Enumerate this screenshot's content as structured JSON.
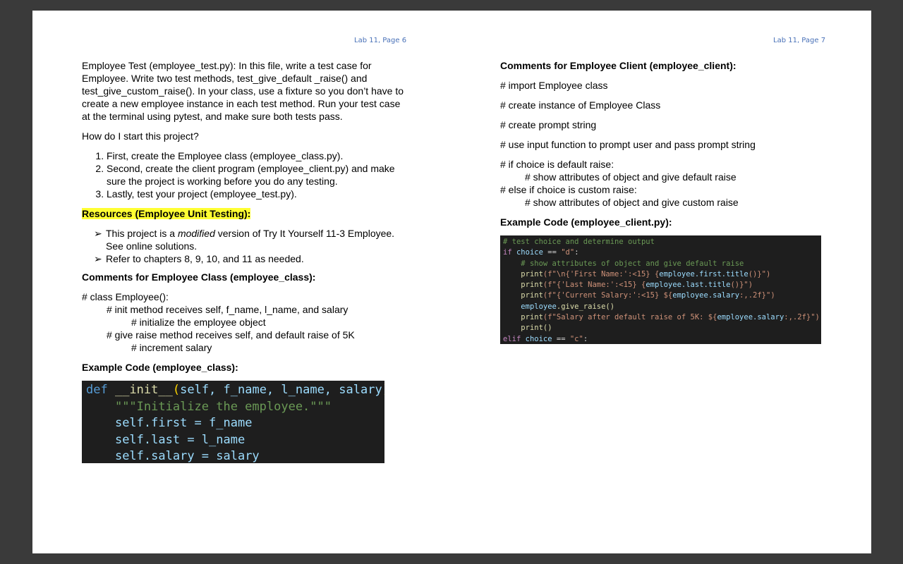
{
  "left_page": {
    "header": "Lab 11, Page 6",
    "intro": "Employee Test (employee_test.py):  In this file, write a test case for Employee. Write two test methods, test_give_default _raise() and test_give_custom_raise().  In your class, use a fixture so you don’t have to create a new employee instance in each test method. Run your test case at the terminal using pytest, and make sure both tests pass.",
    "question": "How do I start this project?",
    "steps": [
      "First, create the Employee class (employee_class.py).",
      "Second, create the client program (employee_client.py) and make sure the project is working before you do any testing.",
      "Lastly, test your project (employee_test.py)."
    ],
    "resources_heading": "Resources (Employee Unit Testing):",
    "resources": {
      "item1_pre": "This project is a ",
      "item1_em": "modified",
      "item1_post": " version of Try It Yourself 11-3 Employee. See online solutions.",
      "item2": "Refer to chapters 8, 9, 10, and 11 as needed.",
      "arrow": "➢"
    },
    "comments_heading": "Comments for Employee Class (employee_class):",
    "comments": [
      "# class Employee():",
      "# init method receives self, f_name, l_name, and salary",
      "# initialize the employee object",
      "# give raise method receives self, and default raise of 5K",
      "# increment salary"
    ],
    "example_heading": "Example Code (employee_class):",
    "code": {
      "l1_def": "def",
      "l1_name": "__init__",
      "l1_open": "(",
      "l1_params": "self, f_name, l_name, salary",
      "l1_close": ")",
      "l1_colon": ":",
      "l2_doc": "\"\"\"Initialize the employee.\"\"\"",
      "l3_self": "self",
      "l3_rest": ".first = f_name",
      "l4_self": "self",
      "l4_rest": ".last = l_name",
      "l5_self": "self",
      "l5_rest": ".salary = salary"
    }
  },
  "right_page": {
    "header": "Lab 11, Page 7",
    "comments_heading": "Comments for Employee Client (employee_client):",
    "comments": [
      "# import Employee class",
      "# create instance of Employee Class",
      "# create prompt string",
      "# use input function to prompt user and pass prompt string",
      "# if choice is default raise:",
      "# show attributes of object and give default raise",
      "# else if choice is custom raise:",
      "# show attributes of object and give custom raise"
    ],
    "example_heading": "Example Code (employee_client.py):",
    "code": {
      "l1": "# test choice and determine output",
      "l2_if": "if",
      "l2_var": "choice",
      "l2_op": " == ",
      "l2_str": "\"d\"",
      "l2_colon": ":",
      "l3": "# show attributes of object and give default raise",
      "l4_fn": "print",
      "l4_a": "(f\"\\n{'First Name:'",
      "l4_b": ":<15} {",
      "l4_c": "employee.first.title",
      "l4_d": "()}\")",
      "l5_fn": "print",
      "l5_a": "(f\"{'Last Name:'",
      "l5_b": ":<15} {",
      "l5_c": "employee.last.title",
      "l5_d": "()}\")",
      "l6_fn": "print",
      "l6_a": "(f\"{'Current Salary:'",
      "l6_b": ":<15} ${",
      "l6_c": "employee.salary",
      "l6_d": ":,.2f}\")",
      "l7_var": "employee",
      "l7_rest": ".give_raise()",
      "l8_fn": "print",
      "l8_a": "(f\"Salary after default raise of 5K: ${",
      "l8_c": "employee.salary",
      "l8_d": ":,.2f}\")",
      "l9": "print()",
      "l10_elif": "elif",
      "l10_var": "choice",
      "l10_op": " == ",
      "l10_str": "\"c\"",
      "l10_colon": ":"
    }
  }
}
